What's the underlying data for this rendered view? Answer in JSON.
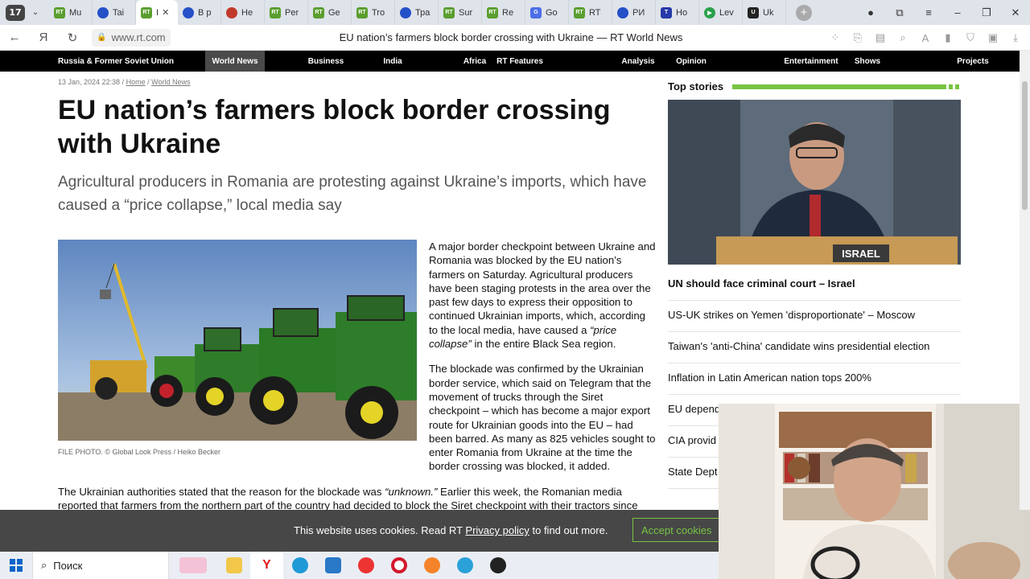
{
  "browser": {
    "tab_count": "17",
    "tabs": [
      {
        "label": "Mu",
        "icon": "rt-icon"
      },
      {
        "label": "Tai",
        "icon": "globe-icon"
      },
      {
        "label": "I",
        "icon": "rt-icon",
        "active": true
      },
      {
        "label": "В р",
        "icon": "globe-icon"
      },
      {
        "label": "He",
        "icon": "red-circle-icon"
      },
      {
        "label": "Per",
        "icon": "rt-icon"
      },
      {
        "label": "Ge",
        "icon": "rt-icon"
      },
      {
        "label": "Tro",
        "icon": "rt-icon"
      },
      {
        "label": "Тра",
        "icon": "globe-icon"
      },
      {
        "label": "Sur",
        "icon": "rt-icon"
      },
      {
        "label": "Re",
        "icon": "rt-icon"
      },
      {
        "label": "Go",
        "icon": "translate-icon"
      },
      {
        "label": "RT",
        "icon": "rt-icon"
      },
      {
        "label": "РИ",
        "icon": "globe-icon"
      },
      {
        "label": "Но",
        "icon": "t-icon"
      },
      {
        "label": "Lev",
        "icon": "play-icon"
      },
      {
        "label": "Uk",
        "icon": "uk-icon"
      }
    ],
    "url": "www.rt.com",
    "page_title": "EU nation’s farmers block border crossing with Ukraine — RT World News"
  },
  "site_nav": [
    "Russia & Former Soviet Union",
    "World News",
    "Business",
    "India",
    "Africa",
    "RT Features",
    "Analysis",
    "Opinion",
    "Entertainment",
    "Shows",
    "Projects"
  ],
  "article": {
    "date": "13 Jan, 2024 22:38",
    "sep": " / ",
    "breadcrumb_home": "Home",
    "breadcrumb_section": "World News",
    "headline": "EU nation’s farmers block border crossing with Ukraine",
    "subhead": "Agricultural producers in Romania are protesting against Ukraine’s imports, which have caused a “price collapse,” local media say",
    "photo_caption": "FILE PHOTO. © Global Look Press / Heiko Becker",
    "p1_a": "A major border checkpoint between Ukraine and Romania was blocked by the EU nation’s farmers on Saturday. Agricultural producers have been staging protests in the area over the past few days to express their opposition to continued Ukrainian imports, which, according to the local media, have caused a ",
    "p1_quote": "“price collapse”",
    "p1_b": " in the entire Black Sea region.",
    "p2": "The blockade was confirmed by the Ukrainian border service, which said on Telegram that the movement of trucks through the Siret checkpoint – which has become a major export route for Ukrainian goods into the EU – had been barred. As many as 825 vehicles sought to enter Romania from Ukraine at the time the border crossing was blocked, it added.",
    "p3_a": "The Ukrainian authorities stated that the reason for the blockade was ",
    "p3_quote": "“unknown.”",
    "p3_b": " Earlier this week, the Romanian media reported that farmers from the northern part of the country had decided to block the Siret checkpoint with their tractors since"
  },
  "sidebar": {
    "title": "Top stories",
    "stories": [
      "UN should face criminal court – Israel",
      "US-UK strikes on Yemen 'disproportionate' – Moscow",
      "Taiwan's 'anti-China' candidate wins presidential election",
      "Inflation in Latin American nation tops 200%",
      "EU depend",
      "CIA provid",
      "State Dept – TASS"
    ],
    "image_label": "ISRAEL"
  },
  "cookie": {
    "text_before": "This website uses cookies. Read RT ",
    "link": "Privacy policy",
    "text_after": " to find out more.",
    "accept": "Accept cookies"
  },
  "taskbar": {
    "search_placeholder": "Поиск"
  },
  "colors": {
    "rt_green": "#77c442",
    "nav_bg": "#000000",
    "nav_active": "#4a4a4a"
  }
}
